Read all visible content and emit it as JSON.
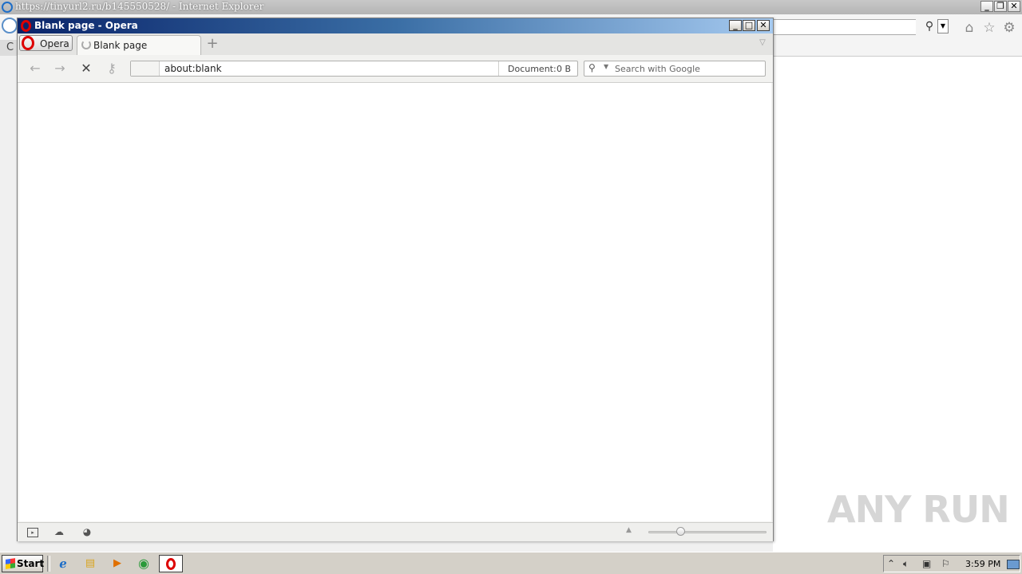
{
  "ie": {
    "title": "https://tinyurl2.ru/b145550528/ - Internet Explorer",
    "buttons": {
      "minimize": "_",
      "restore": "❐",
      "close": "✕"
    },
    "tab_partial": "C",
    "icons": [
      "home-icon",
      "star-icon",
      "gear-icon"
    ]
  },
  "opera": {
    "title": "Blank page - Opera",
    "menu_label": "Opera",
    "tab_label": "Blank page",
    "new_tab": "+",
    "address": "about:blank",
    "document_label": "Document:",
    "document_value": "0 B",
    "search_placeholder": "Search with Google",
    "window_buttons": {
      "minimize": "_",
      "maximize": "□",
      "close": "✕"
    }
  },
  "taskbar": {
    "start_label": "Start",
    "clock": "3:59 PM",
    "apps": [
      "internet-explorer-icon",
      "file-explorer-icon",
      "media-player-icon",
      "chrome-icon",
      "opera-icon"
    ]
  },
  "watermark": "ANY RUN",
  "colors": {
    "opera_red": "#dd0000",
    "title_blue": "#0a246a"
  }
}
